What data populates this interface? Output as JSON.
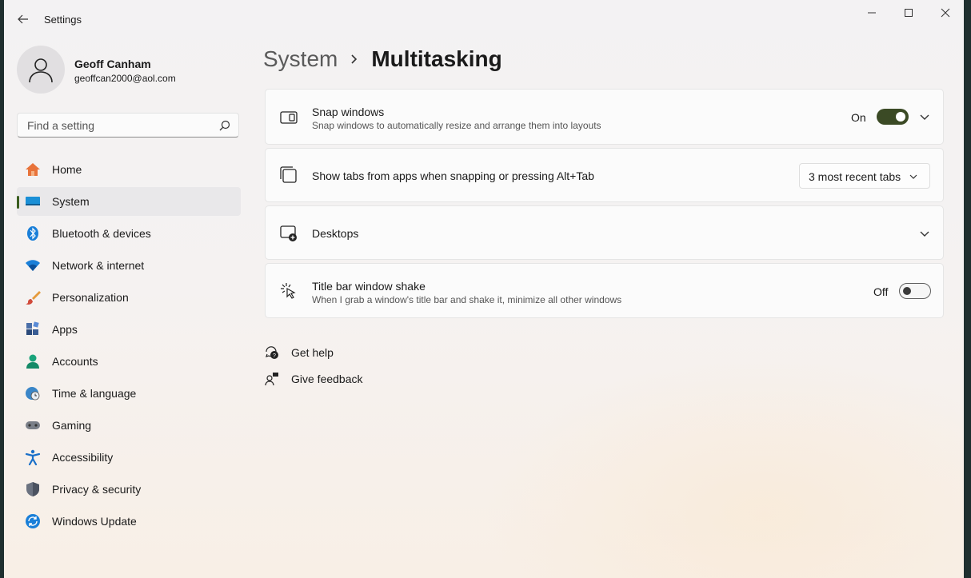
{
  "window": {
    "title": "Settings",
    "controls": {
      "minimize_icon": "minimize-icon",
      "maximize_icon": "maximize-icon",
      "close_icon": "close-icon"
    }
  },
  "profile": {
    "name": "Geoff Canham",
    "email": "geoffcan2000@aol.com"
  },
  "search": {
    "placeholder": "Find a setting"
  },
  "sidebar": {
    "items": [
      {
        "label": "Home",
        "icon": "home-icon",
        "active": false
      },
      {
        "label": "System",
        "icon": "system-icon",
        "active": true
      },
      {
        "label": "Bluetooth & devices",
        "icon": "bluetooth-icon",
        "active": false
      },
      {
        "label": "Network & internet",
        "icon": "wifi-icon",
        "active": false
      },
      {
        "label": "Personalization",
        "icon": "brush-icon",
        "active": false
      },
      {
        "label": "Apps",
        "icon": "apps-icon",
        "active": false
      },
      {
        "label": "Accounts",
        "icon": "accounts-icon",
        "active": false
      },
      {
        "label": "Time & language",
        "icon": "globe-clock-icon",
        "active": false
      },
      {
        "label": "Gaming",
        "icon": "gamepad-icon",
        "active": false
      },
      {
        "label": "Accessibility",
        "icon": "accessibility-icon",
        "active": false
      },
      {
        "label": "Privacy & security",
        "icon": "shield-icon",
        "active": false
      },
      {
        "label": "Windows Update",
        "icon": "update-icon",
        "active": false
      }
    ]
  },
  "header": {
    "parent": "System",
    "current": "Multitasking"
  },
  "settings": {
    "snap": {
      "title": "Snap windows",
      "subtitle": "Snap windows to automatically resize and arrange them into layouts",
      "state": "On",
      "enabled": true
    },
    "tabs": {
      "title": "Show tabs from apps when snapping or pressing Alt+Tab",
      "value": "3 most recent tabs"
    },
    "desktops": {
      "title": "Desktops"
    },
    "shake": {
      "title": "Title bar window shake",
      "subtitle": "When I grab a window's title bar and shake it, minimize all other windows",
      "state": "Off",
      "enabled": false
    }
  },
  "links": {
    "help": "Get help",
    "feedback": "Give feedback"
  },
  "colors": {
    "accent": "#3b4a25",
    "active_indicator": "#3b5e1f"
  }
}
